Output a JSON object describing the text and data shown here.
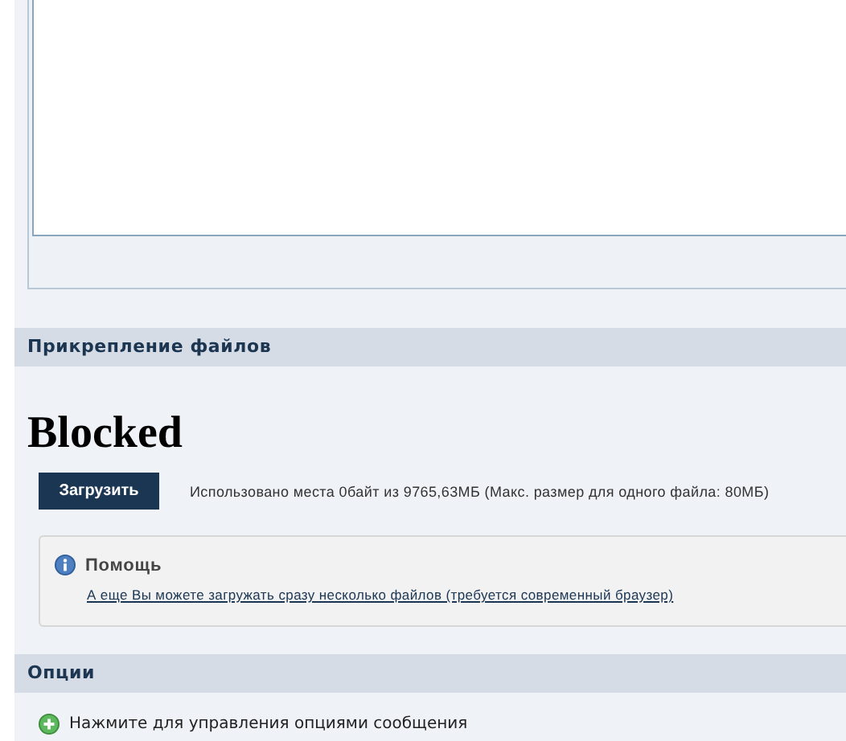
{
  "editor": {
    "kind": "textarea"
  },
  "attachments": {
    "title": "Прикрепление файлов",
    "blocked_text": "Blocked",
    "upload_button": "Загрузить",
    "usage": "Использовано места 0байт из 9765,63МБ (Макс. размер для одного файла: 80МБ)",
    "help": {
      "title": "Помощь",
      "link": "А еще Вы можете загружать сразу несколько файлов (требуется современный браузер)"
    }
  },
  "options": {
    "title": "Опции",
    "toggle": "Нажмите для управления опциями сообщения"
  }
}
